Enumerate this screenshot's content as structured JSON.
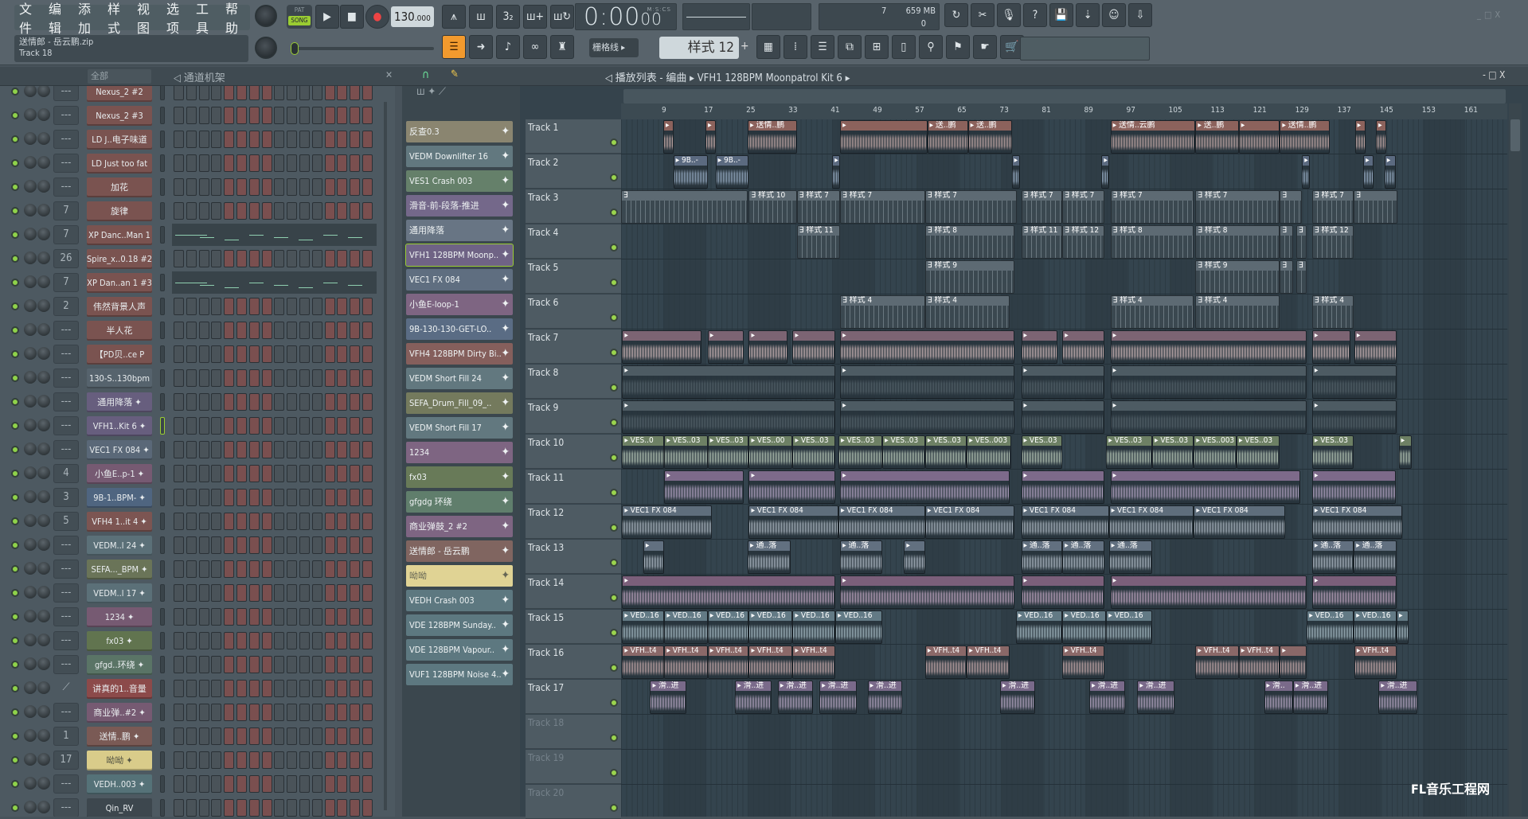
{
  "menu": [
    "文件",
    "编辑",
    "添加",
    "样式",
    "视图",
    "选项",
    "工具",
    "帮助"
  ],
  "song": {
    "title": "送情郎 - 岳云鹏.zip",
    "hint": "Track 18"
  },
  "transport": {
    "pat_label": "PAT",
    "song_label": "SONG",
    "tempo": "130",
    "tempo_frac": ".000",
    "time": "0:00",
    "time_cs": "00",
    "time_unit": "M:S:CS",
    "cpu": "7",
    "mem": "659 MB",
    "poly": "0"
  },
  "snap": "栅格线",
  "pattern": "样式 12",
  "rack": {
    "filter": "全部",
    "title": "通道机架"
  },
  "playlist": {
    "title": "播放列表 - 编曲",
    "current": "VFH1 128BPM Moonpatrol Kit 6"
  },
  "colors": {
    "accent": "#f29a2e",
    "led": "#9ad44e",
    "step_gray": "#4a5359",
    "step_red": "#7a4f4f"
  },
  "channels": [
    {
      "name": "Nexus_2 #2",
      "mix": "---",
      "color": "#7a5350"
    },
    {
      "name": "Nexus_2 #3",
      "mix": "---",
      "color": "#7a5350"
    },
    {
      "name": "LD J..电子味道",
      "mix": "---",
      "color": "#7a5350"
    },
    {
      "name": "LD Just too fat",
      "mix": "---",
      "color": "#7a5350"
    },
    {
      "name": "加花",
      "mix": "---",
      "color": "#7a5350"
    },
    {
      "name": "旋律",
      "mix": "7",
      "color": "#7a5350"
    },
    {
      "name": "XP Danc..Man 1",
      "mix": "7",
      "color": "#7a5350",
      "roll": true
    },
    {
      "name": "Spire_x..0.18 #2",
      "mix": "26",
      "color": "#7a5350"
    },
    {
      "name": "XP Dan..an 1 #3",
      "mix": "7",
      "color": "#7a5350",
      "roll": true
    },
    {
      "name": "伟然背景人声",
      "mix": "2",
      "color": "#7a5350"
    },
    {
      "name": "半人花",
      "mix": "---",
      "color": "#7a5350"
    },
    {
      "name": "【PD贝..ce P",
      "mix": "---",
      "color": "#7a5350"
    },
    {
      "name": "130-S..130bpm",
      "mix": "---",
      "color": "#56636d"
    },
    {
      "name": "通用降落 ✦",
      "mix": "---",
      "color": "#675e7e"
    },
    {
      "name": "VFH1..Kit 6 ✦",
      "mix": "---",
      "color": "#675e7e",
      "selected": true
    },
    {
      "name": "VEC1 FX 084 ✦",
      "mix": "---",
      "color": "#5a6878"
    },
    {
      "name": "小鱼E..p-1 ✦",
      "mix": "4",
      "color": "#765a72"
    },
    {
      "name": "9B-1..BPM- ✦",
      "mix": "3",
      "color": "#4f6580"
    },
    {
      "name": "VFH4 1..it 4 ✦",
      "mix": "5",
      "color": "#7c5552"
    },
    {
      "name": "VEDM..l 24 ✦",
      "mix": "---",
      "color": "#5b7078"
    },
    {
      "name": "SEFA..._BPM ✦",
      "mix": "---",
      "color": "#6a7458"
    },
    {
      "name": "VEDM..l 17 ✦",
      "mix": "---",
      "color": "#5b7078"
    },
    {
      "name": "1234 ✦",
      "mix": "---",
      "color": "#765a72"
    },
    {
      "name": "fx03 ✦",
      "mix": "---",
      "color": "#61744f"
    },
    {
      "name": "gfgd..环绕 ✦",
      "mix": "---",
      "color": "#5a7466"
    },
    {
      "name": "讲真的1..音量",
      "mix": "",
      "color": "#8c4a4a",
      "link": true
    },
    {
      "name": "商业弹..#2 ✦",
      "mix": "---",
      "color": "#765a72"
    },
    {
      "name": "送情..鹏 ✦",
      "mix": "1",
      "color": "#7a5a55"
    },
    {
      "name": "呦呦 ✦",
      "mix": "17",
      "color": "#d9cc8a"
    },
    {
      "name": "VEDH..003 ✦",
      "mix": "---",
      "color": "#557278"
    },
    {
      "name": "Qin_RV",
      "mix": "---",
      "color": "#3d474e"
    }
  ],
  "picker": [
    {
      "name": "反查0.3",
      "color": "#8a8570"
    },
    {
      "name": "VEDM Downlifter 16",
      "color": "#62787f"
    },
    {
      "name": "VES1 Crash 003",
      "color": "#65806a"
    },
    {
      "name": "滑音-前-段落-推进",
      "color": "#74688a"
    },
    {
      "name": "通用降落",
      "color": "#687584"
    },
    {
      "name": "VFH1 128BPM Moonp..",
      "color": "#6f6385",
      "selected": true
    },
    {
      "name": "VEC1 FX 084",
      "color": "#5f6e80"
    },
    {
      "name": "小鱼E-loop-1",
      "color": "#7e6582"
    },
    {
      "name": "9B-130-130-GET-LO..",
      "color": "#5a6c84"
    },
    {
      "name": "VFH4 128BPM Dirty Bi..",
      "color": "#855f5c"
    },
    {
      "name": "VEDM Short Fill 24",
      "color": "#62787f"
    },
    {
      "name": "SEFA_Drum_Fill_09_..",
      "color": "#747a5d"
    },
    {
      "name": "VEDM Short Fill 17",
      "color": "#62787f"
    },
    {
      "name": "1234",
      "color": "#7e6582"
    },
    {
      "name": "fx03",
      "color": "#687a58"
    },
    {
      "name": "gfgdg 环绕",
      "color": "#607e6c"
    },
    {
      "name": "商业弹鼓_2 #2",
      "color": "#7e6582"
    },
    {
      "name": "送情郎 - 岳云鹏",
      "color": "#806560"
    },
    {
      "name": "呦呦",
      "color": "#e0d394"
    },
    {
      "name": "VEDH Crash 003",
      "color": "#5d7880"
    },
    {
      "name": "VDE 128BPM Sunday..",
      "color": "#5d7880"
    },
    {
      "name": "VDE 128BPM Vapour..",
      "color": "#5d7880"
    },
    {
      "name": "VUF1 128BPM Noise 4..",
      "color": "#5d7880"
    }
  ],
  "ruler": [
    9,
    17,
    25,
    33,
    41,
    49,
    57,
    65,
    73,
    81,
    89,
    97,
    105,
    113,
    121,
    129,
    137,
    145,
    153,
    161
  ],
  "tracks": [
    {
      "name": "Track 1",
      "head": "#8c625c",
      "wave": "#d9b9b6",
      "clips": [
        [
          9,
          11,
          ""
        ],
        [
          17,
          19,
          ""
        ],
        [
          25,
          34.3,
          "送情..鹏"
        ],
        [
          42.5,
          59,
          ""
        ],
        [
          59,
          66.7,
          "送..鹏"
        ],
        [
          66.7,
          75,
          "送..鹏"
        ],
        [
          93.7,
          109.8,
          "送情..云鹏"
        ],
        [
          109.8,
          118,
          "送..鹏"
        ],
        [
          118,
          125.8,
          ""
        ],
        [
          125.8,
          135.3,
          "送情..鹏"
        ],
        [
          140,
          142,
          ""
        ],
        [
          144,
          146,
          ""
        ]
      ]
    },
    {
      "name": "Track 2",
      "head": "#5b6a80",
      "wave": "#a9bfd9",
      "clips": [
        [
          10.9,
          17.4,
          "9B..-"
        ],
        [
          18.9,
          25.2,
          "9B..-"
        ],
        [
          41,
          42.5,
          ""
        ],
        [
          75,
          76.5,
          ""
        ],
        [
          92,
          93.5,
          ""
        ],
        [
          130,
          131.5,
          ""
        ],
        [
          141.6,
          143.5,
          ""
        ],
        [
          145.6,
          147.7,
          ""
        ]
      ]
    },
    {
      "name": "Track 3",
      "head": "#5d6a73",
      "wave": "#9aa7b0",
      "pattern": true,
      "clips": [
        [
          1,
          25,
          ""
        ],
        [
          25.2,
          34.3,
          "样式 10"
        ],
        [
          34.3,
          42.5,
          "样式 7"
        ],
        [
          42.5,
          58.6,
          "样式 7"
        ],
        [
          58.6,
          76,
          "样式 7"
        ],
        [
          76.8,
          84.6,
          "样式 7"
        ],
        [
          84.6,
          92.5,
          "样式 7"
        ],
        [
          93.7,
          109.5,
          "样式 7"
        ],
        [
          109.8,
          125.8,
          "样式 7"
        ],
        [
          125.8,
          130,
          ""
        ],
        [
          131.9,
          139.8,
          "样式 7"
        ],
        [
          139.8,
          148,
          ""
        ]
      ]
    },
    {
      "name": "Track 4",
      "head": "#5d6a73",
      "wave": "#9aa7b0",
      "pattern": true,
      "clips": [
        [
          34.3,
          42.5,
          "样式 11"
        ],
        [
          58.6,
          75.5,
          "样式 8"
        ],
        [
          76.8,
          84.6,
          "样式 11"
        ],
        [
          84.6,
          92.5,
          "样式 12"
        ],
        [
          93.7,
          109.5,
          "样式 8"
        ],
        [
          109.8,
          125.8,
          "样式 8"
        ],
        [
          125.8,
          128.3,
          ""
        ],
        [
          128.9,
          130.9,
          ""
        ],
        [
          131.9,
          139.8,
          "样式 12"
        ]
      ]
    },
    {
      "name": "Track 5",
      "head": "#5d6a73",
      "wave": "#9aa7b0",
      "pattern": true,
      "clips": [
        [
          58.6,
          75.5,
          "样式 9"
        ],
        [
          109.8,
          125.8,
          "样式 9"
        ],
        [
          125.8,
          128.3,
          ""
        ],
        [
          128.9,
          130.9,
          ""
        ]
      ]
    },
    {
      "name": "Track 6",
      "head": "#5d6a73",
      "wave": "#9aa7b0",
      "pattern": true,
      "clips": [
        [
          42.5,
          58.6,
          "样式 4"
        ],
        [
          58.6,
          74.6,
          "样式 4"
        ],
        [
          93.7,
          109.5,
          "样式 4"
        ],
        [
          109.8,
          125.8,
          "样式 4"
        ],
        [
          131.9,
          139.8,
          "样式 4"
        ]
      ]
    },
    {
      "name": "Track 7",
      "head": "#7c6473",
      "wave": "#e6c9c9",
      "clips": [
        [
          1.2,
          16.2,
          ""
        ],
        [
          17.4,
          24.3,
          ""
        ],
        [
          25.2,
          32.5,
          ""
        ],
        [
          33.5,
          41.6,
          ""
        ],
        [
          42.5,
          75.5,
          ""
        ],
        [
          76.8,
          83.7,
          ""
        ],
        [
          84.6,
          92.5,
          ""
        ],
        [
          93.7,
          130.9,
          ""
        ],
        [
          131.9,
          139.2,
          ""
        ],
        [
          139.9,
          147.9,
          ""
        ]
      ]
    },
    {
      "name": "Track 8",
      "head": "#4d5b63",
      "wave": "#5a6870",
      "clips": [
        [
          1.2,
          41.6,
          ""
        ],
        [
          42.5,
          75.5,
          ""
        ],
        [
          76.8,
          92.5,
          ""
        ],
        [
          93.7,
          130.9,
          ""
        ],
        [
          131.9,
          147.9,
          ""
        ]
      ]
    },
    {
      "name": "Track 9",
      "head": "#4d5b63",
      "wave": "#5a6870",
      "clips": [
        [
          1.2,
          41.6,
          ""
        ],
        [
          42.5,
          75.5,
          ""
        ],
        [
          76.8,
          92.5,
          ""
        ],
        [
          93.7,
          130.9,
          ""
        ],
        [
          131.9,
          147.9,
          ""
        ]
      ]
    },
    {
      "name": "Track 10",
      "head": "#6d8064",
      "wave": "#cfe0cc",
      "clips": [
        [
          1.2,
          9.2,
          "VES..0"
        ],
        [
          9.2,
          17.4,
          "VES..03"
        ],
        [
          17.4,
          25.2,
          "VES..03"
        ],
        [
          25.2,
          33.5,
          "VES..00"
        ],
        [
          33.5,
          41.6,
          "VES..03"
        ],
        [
          42.2,
          50.5,
          "VES..03"
        ],
        [
          50.5,
          58.6,
          "VES..03"
        ],
        [
          58.6,
          66.5,
          "VES..03"
        ],
        [
          66.5,
          74.9,
          "VES..003"
        ],
        [
          76.8,
          84.6,
          "VES..03"
        ],
        [
          92.9,
          101.6,
          "VES..03"
        ],
        [
          101.6,
          109.5,
          "VES..03"
        ],
        [
          109.5,
          117.6,
          "VES..003"
        ],
        [
          117.6,
          125.8,
          "VES..03"
        ],
        [
          131.9,
          139.8,
          "VES..03"
        ],
        [
          148.3,
          150.7,
          ""
        ]
      ]
    },
    {
      "name": "Track 11",
      "head": "#7d6a8a",
      "wave": "#c9b6d9",
      "clips": [
        [
          9.2,
          24.3,
          ""
        ],
        [
          25.2,
          41.6,
          ""
        ],
        [
          42.5,
          74.6,
          ""
        ],
        [
          76.8,
          92.5,
          ""
        ],
        [
          93.7,
          129.7,
          ""
        ],
        [
          131.9,
          147.7,
          ""
        ]
      ]
    },
    {
      "name": "Track 12",
      "head": "#5f6e7c",
      "wave": "#c1ccd6",
      "clips": [
        [
          1.2,
          18.2,
          "VEC1 FX 084"
        ],
        [
          25.2,
          42.2,
          "VEC1 FX 084"
        ],
        [
          42.2,
          58.6,
          "VEC1 FX 084"
        ],
        [
          58.6,
          75.5,
          "VEC1 FX 084"
        ],
        [
          76.8,
          93.4,
          "VEC1 FX 084"
        ],
        [
          93.4,
          109.5,
          "VEC1 FX 084"
        ],
        [
          109.5,
          126.8,
          "VEC1 FX 084"
        ],
        [
          131.9,
          148.9,
          "VEC1 FX 084"
        ]
      ]
    },
    {
      "name": "Track 13",
      "head": "#627080",
      "wave": "#c6d0dc",
      "clips": [
        [
          5.2,
          9.2,
          ""
        ],
        [
          25,
          33.1,
          "通..落"
        ],
        [
          42.5,
          50.5,
          "通..落"
        ],
        [
          54.6,
          58.6,
          ""
        ],
        [
          76.8,
          84.6,
          "通..落"
        ],
        [
          84.6,
          92.5,
          "通..落"
        ],
        [
          93.4,
          101.6,
          "通..落"
        ],
        [
          131.9,
          139.8,
          "通..落"
        ],
        [
          139.8,
          147.9,
          "通..落"
        ]
      ]
    },
    {
      "name": "Track 14",
      "head": "#7b5f7a",
      "wave": "#d9b8d6",
      "clips": [
        [
          1.2,
          41.6,
          ""
        ],
        [
          42.5,
          75.5,
          ""
        ],
        [
          76.8,
          92.5,
          ""
        ],
        [
          93.7,
          130.9,
          ""
        ],
        [
          131.9,
          147.9,
          ""
        ]
      ]
    },
    {
      "name": "Track 15",
      "head": "#637a85",
      "wave": "#bcd3dc",
      "clips": [
        [
          1.2,
          9.2,
          "VED..16"
        ],
        [
          9.2,
          17.4,
          "VED..16"
        ],
        [
          17.4,
          25.2,
          "VED..16"
        ],
        [
          25.2,
          33.5,
          "VED..16"
        ],
        [
          33.5,
          41.6,
          "VED..16"
        ],
        [
          41.6,
          50.5,
          "VED..16"
        ],
        [
          75.8,
          84.6,
          "VED..16"
        ],
        [
          84.6,
          92.9,
          "VED..16"
        ],
        [
          92.9,
          101.6,
          "VED..16"
        ],
        [
          130.9,
          139.8,
          "VED..16"
        ],
        [
          139.8,
          147.9,
          "VED..16"
        ],
        [
          147.9,
          150.1,
          ""
        ]
      ]
    },
    {
      "name": "Track 16",
      "head": "#8a6868",
      "wave": "#e0bcbc",
      "clips": [
        [
          1.2,
          9.2,
          "VFH..t4"
        ],
        [
          9.2,
          17.4,
          "VFH..t4"
        ],
        [
          17.4,
          25.2,
          "VFH..t4"
        ],
        [
          25.2,
          33.5,
          "VFH..t4"
        ],
        [
          33.5,
          41.6,
          "VFH..t4"
        ],
        [
          58.6,
          66.5,
          "VFH..t4"
        ],
        [
          66.5,
          74.6,
          "VFH..t4"
        ],
        [
          84.6,
          92.5,
          "VFH..t4"
        ],
        [
          109.8,
          118,
          "VFH..t4"
        ],
        [
          118,
          125.8,
          "VFH..t4"
        ],
        [
          125.8,
          130.9,
          ""
        ],
        [
          139.9,
          147.9,
          "VFH..t4"
        ]
      ]
    },
    {
      "name": "Track 17",
      "head": "#7a6a8a",
      "wave": "#cdb9d9",
      "clips": [
        [
          6.5,
          13.4,
          "滑..进"
        ],
        [
          22.6,
          29.5,
          "滑..进"
        ],
        [
          30.7,
          37.4,
          "滑..进"
        ],
        [
          38.6,
          45.6,
          "滑..进"
        ],
        [
          47.7,
          54.3,
          "滑..进"
        ],
        [
          72.8,
          79.5,
          "滑..进"
        ],
        [
          89.7,
          96.5,
          "滑..进"
        ],
        [
          98.8,
          105.8,
          "滑..进"
        ],
        [
          122.8,
          128.3,
          "滑.."
        ],
        [
          128.3,
          134.9,
          "滑..进"
        ],
        [
          144.5,
          151.9,
          "滑..进"
        ]
      ]
    },
    {
      "name": "Track 18",
      "dim": true,
      "clips": []
    },
    {
      "name": "Track 19",
      "dim": true,
      "clips": []
    },
    {
      "name": "Track 20",
      "dim": true,
      "clips": []
    }
  ],
  "watermark": "FL音乐工程网"
}
